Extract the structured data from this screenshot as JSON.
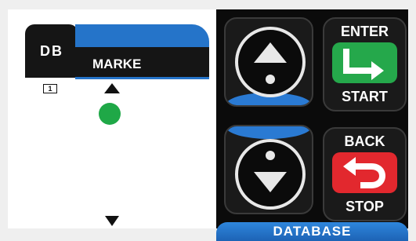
{
  "lcd": {
    "tab_label": "DB",
    "title": "MARKE",
    "page_number": "1"
  },
  "buttons": {
    "enter_label": "ENTER",
    "start_label": "START",
    "back_label": "BACK",
    "stop_label": "STOP"
  },
  "footer": {
    "label": "DATABASE"
  },
  "colors": {
    "accent_blue": "#2574c9",
    "enter_green": "#25a84b",
    "back_red": "#e2282e",
    "status_dot": "#1fa847"
  },
  "icons": [
    "up-arrow-icon",
    "status-dot-icon",
    "down-arrow-icon",
    "enter-arrow-icon",
    "back-arrow-icon"
  ]
}
